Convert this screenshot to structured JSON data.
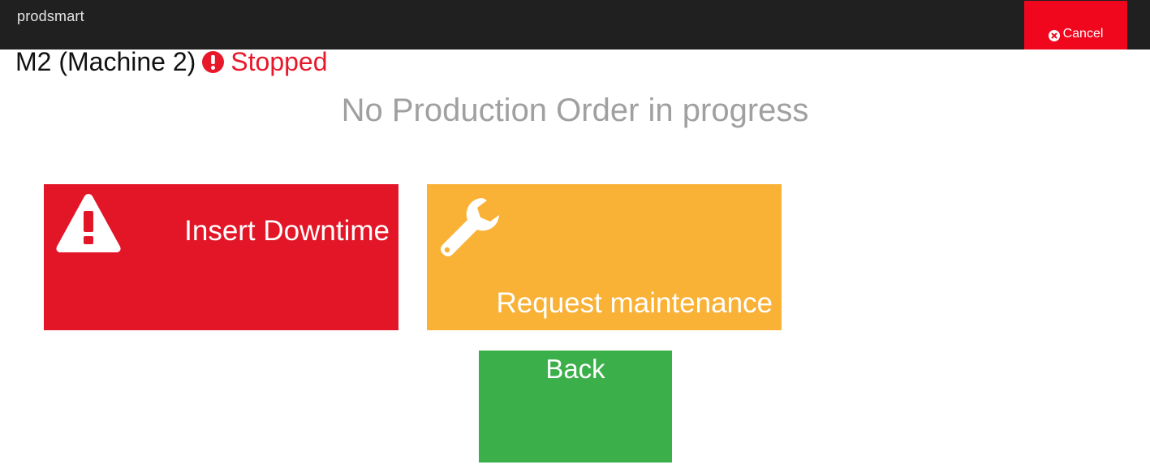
{
  "header": {
    "brand": "prodsmart",
    "cancel_label": "Cancel",
    "cancel_icon": "times-circle-icon"
  },
  "machine": {
    "name": "M2 (Machine 2)",
    "status_icon": "exclamation-circle-icon",
    "status": "Stopped"
  },
  "message": "No Production Order in progress",
  "actions": {
    "downtime": {
      "label": "Insert Downtime",
      "icon": "warning-triangle-icon",
      "color": "#e31627"
    },
    "maintenance": {
      "label": "Request maintenance",
      "icon": "wrench-icon",
      "color": "#f9b136"
    },
    "back": {
      "label": "Back",
      "color": "#3baf49"
    }
  },
  "colors": {
    "topbar": "#202020",
    "cancel": "#f0061d",
    "status_stopped": "#e8182b",
    "message": "#a0a0a0"
  }
}
